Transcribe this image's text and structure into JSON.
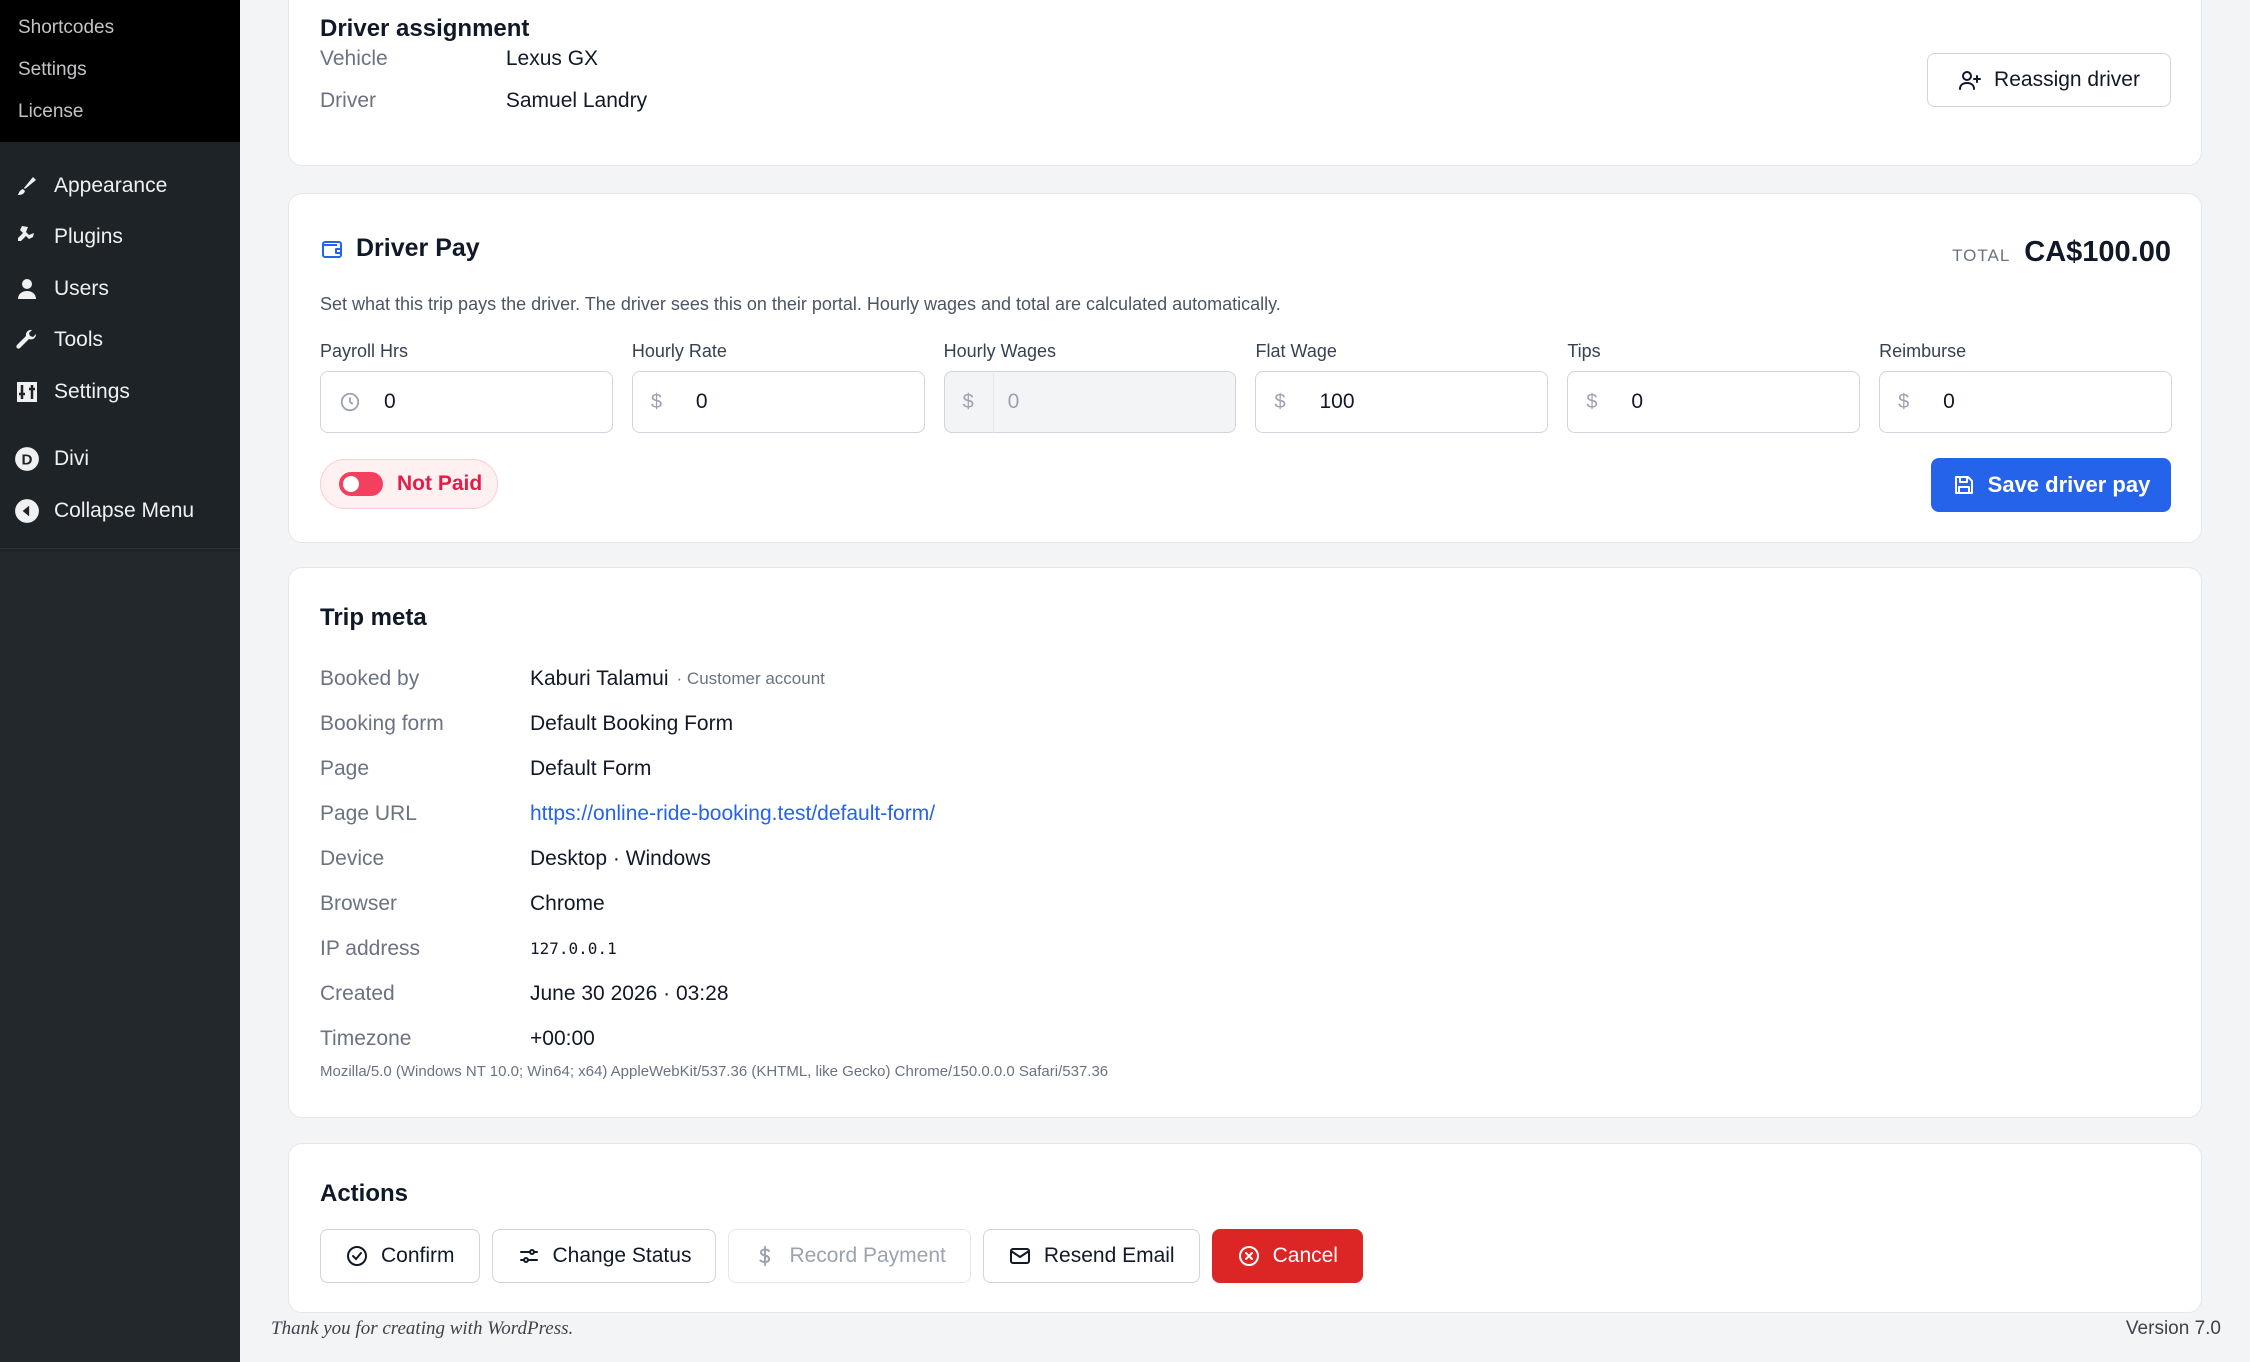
{
  "sidebar": {
    "submenu": [
      "Shortcodes",
      "Settings",
      "License"
    ],
    "menu": [
      {
        "label": "Appearance",
        "icon": "paintbrush-icon"
      },
      {
        "label": "Plugins",
        "icon": "plugin-icon"
      },
      {
        "label": "Users",
        "icon": "user-icon"
      },
      {
        "label": "Tools",
        "icon": "wrench-icon"
      },
      {
        "label": "Settings",
        "icon": "settings-icon"
      }
    ],
    "divi": {
      "label": "Divi",
      "icon": "divi-icon"
    },
    "collapse": {
      "label": "Collapse Menu",
      "icon": "collapse-icon"
    }
  },
  "driver_assignment": {
    "title": "Driver assignment",
    "vehicle_label": "Vehicle",
    "vehicle_value": "Lexus GX",
    "driver_label": "Driver",
    "driver_value": "Samuel Landry",
    "reassign_label": "Reassign driver"
  },
  "driver_pay": {
    "title": "Driver Pay",
    "total_label": "TOTAL",
    "total_value": "CA$100.00",
    "description": "Set what this trip pays the driver. The driver sees this on their portal. Hourly wages and total are calculated automatically.",
    "fields": [
      {
        "label": "Payroll Hrs",
        "prefix": "",
        "value": "0"
      },
      {
        "label": "Hourly Rate",
        "prefix": "$",
        "value": "0"
      },
      {
        "label": "Hourly Wages",
        "prefix": "$",
        "value": "0"
      },
      {
        "label": "Flat Wage",
        "prefix": "$",
        "value": "100"
      },
      {
        "label": "Tips",
        "prefix": "$",
        "value": "0"
      },
      {
        "label": "Reimburse",
        "prefix": "$",
        "value": "0"
      }
    ],
    "paid_status": "Not Paid",
    "save_label": "Save driver pay"
  },
  "trip_meta": {
    "title": "Trip meta",
    "booked_by_label": "Booked by",
    "booked_by_value": "Kaburi Talamui",
    "booked_by_note": "· Customer account",
    "booking_form_label": "Booking form",
    "booking_form_value": "Default Booking Form",
    "page_label": "Page",
    "page_value": "Default Form",
    "page_url_label": "Page URL",
    "page_url_value": "https://online-ride-booking.test/default-form/",
    "device_label": "Device",
    "device_value": "Desktop · Windows",
    "browser_label": "Browser",
    "browser_value": "Chrome",
    "ip_label": "IP address",
    "ip_value": "127.0.0.1",
    "created_label": "Created",
    "created_value": "June 30 2026 · 03:28",
    "timezone_label": "Timezone",
    "timezone_value": "+00:00",
    "user_agent": "Mozilla/5.0 (Windows NT 10.0; Win64; x64) AppleWebKit/537.36 (KHTML, like Gecko) Chrome/150.0.0.0 Safari/537.36"
  },
  "actions": {
    "title": "Actions",
    "confirm": "Confirm",
    "change_status": "Change Status",
    "record_payment": "Record Payment",
    "resend_email": "Resend Email",
    "cancel": "Cancel"
  },
  "footer": {
    "thanks": "Thank you for creating with WordPress.",
    "version": "Version 7.0"
  },
  "colors": {
    "primary": "#2563eb",
    "danger": "#dc2626",
    "not_paid": "#e11d48",
    "sidebar_bg": "#1d2327"
  }
}
